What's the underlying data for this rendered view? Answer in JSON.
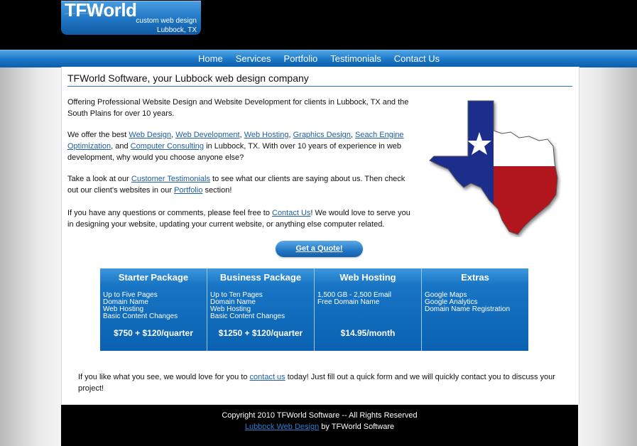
{
  "logo": {
    "title": "TFWorld",
    "tagline_1": "custom web design",
    "tagline_2": "Lubbock, TX"
  },
  "nav": {
    "items": [
      "Home",
      "Services",
      "Portfolio",
      "Testimonials",
      "Contact Us"
    ]
  },
  "main": {
    "title": "TFWorld Software, your Lubbock web design company",
    "p1": "Offering Professional Website Design and Website Development for clients in Lubbock, TX and the South Plains for over 10 years.",
    "p2_a": "We offer the best ",
    "p2_links": [
      "Web Design",
      "Web Development",
      "Web Hosting",
      "Graphics Design",
      "Seach Engine Optimization",
      "Computer Consulting"
    ],
    "p2_sep": ", ",
    "p2_and": ", and ",
    "p2_b": " in Lubbock, TX. With over 10 years of experience in web development, why would you choose anyone else?",
    "p3_a": "Take a look at our ",
    "p3_link1": "Customer Testimonials",
    "p3_b": " to see what our clients are saying about us. Then check out our client's websites in our ",
    "p3_link2": "Portfolio",
    "p3_c": " section!",
    "p4_a": "If you have any questions or comments, please feel free to ",
    "p4_link": "Contact Us",
    "p4_b": "! We would love to serve you in designing your website, updating your current website, or anything else computer related.",
    "quote_button": "Get a Quote!"
  },
  "packages": [
    {
      "name": "Starter Package",
      "items": [
        "Up to Five Pages",
        "Domain Name",
        "Web Hosting",
        "Basic Content Changes"
      ],
      "price": "$750 + $120/quarter"
    },
    {
      "name": "Business Package",
      "items": [
        "Up to Ten Pages",
        "Domain Name",
        "Web Hosting",
        "Basic Content Changes"
      ],
      "price": "$1250 + $120/quarter"
    },
    {
      "name": "Web Hosting",
      "items": [
        "1,500 GB - 2,500 Email",
        "Free Domain Name"
      ],
      "price": "$14.95/month"
    },
    {
      "name": "Extras",
      "items": [
        "Google Maps",
        "Google Analytics",
        "Domain Name Registration"
      ],
      "price": ""
    }
  ],
  "closing": {
    "a": "If you like what you see, we would love for you to ",
    "link": "contact us",
    "b": " today! Just fill out a quick form and we will quickly contact you to discuss your project!"
  },
  "footer": {
    "copyright": "Copyright 2010 TFWorld Software -- All Rights Reserved",
    "link": "Lubbock Web Design",
    "by": " by TFWorld Software"
  },
  "colors": {
    "accent": "#1875c4",
    "link": "#1a5ea8",
    "flag_blue": "#1e2f8c",
    "flag_red": "#b0141c"
  }
}
